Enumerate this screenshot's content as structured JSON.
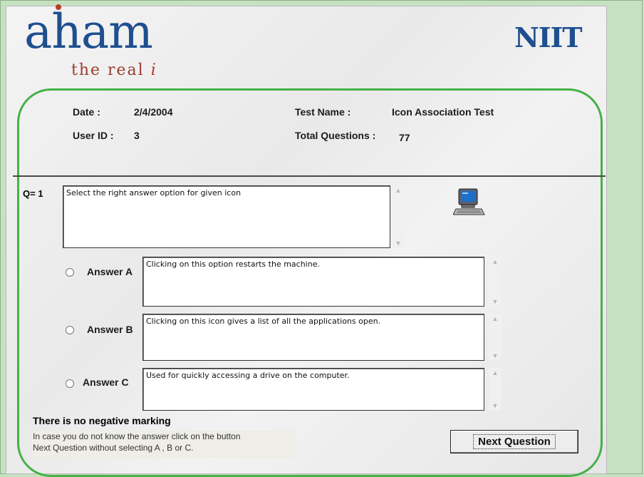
{
  "branding": {
    "logo_text": "aham",
    "tagline": "the real",
    "tagline_i": "i",
    "brand": "NIIT"
  },
  "info": {
    "date_label": "Date :",
    "date_value": "2/4/2004",
    "userid_label": "User ID :",
    "userid_value": "3",
    "testname_label": "Test Name :",
    "testname_value": "Icon Association Test",
    "total_label": "Total Questions :",
    "total_value": "77"
  },
  "question": {
    "number_label": "Q=  1",
    "text": "Select the right answer option for given icon",
    "icon": "computer-icon"
  },
  "answers": [
    {
      "label": "Answer A",
      "text": "Clicking on this option restarts the machine.",
      "selected": false
    },
    {
      "label": "Answer B",
      "text": "Clicking on this icon gives a list of all the applications open.",
      "selected": false
    },
    {
      "label": "Answer C",
      "text": "Used for quickly accessing a drive on the computer.",
      "selected": false
    }
  ],
  "notes": {
    "bold": "There is no negative marking",
    "line1": "In case you do not know the answer click on the button",
    "line2": "Next Question without selecting A , B or C."
  },
  "buttons": {
    "next": "Next Question"
  },
  "colors": {
    "accent_border": "#45b145",
    "logo": "#1f4f8f",
    "background": "#c6e1c0"
  }
}
